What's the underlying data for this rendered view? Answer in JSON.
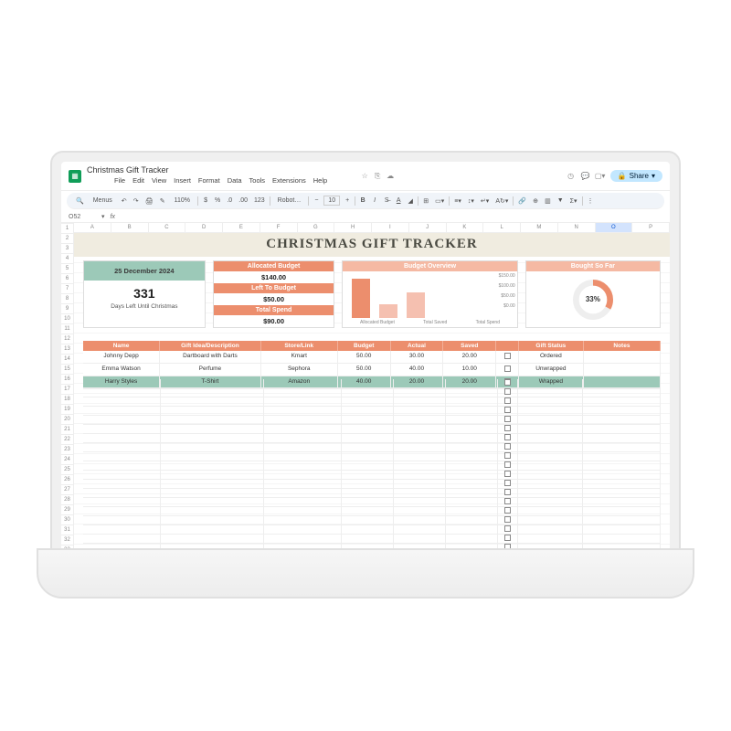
{
  "document": {
    "title": "Christmas Gift Tracker",
    "app_icon": "gsheets"
  },
  "menu": [
    "File",
    "Edit",
    "View",
    "Insert",
    "Format",
    "Data",
    "Tools",
    "Extensions",
    "Help"
  ],
  "toolbar": {
    "zoom": "110%",
    "font": "Robot…",
    "font_size": "10",
    "menus_label": "Menus"
  },
  "header_icons": {
    "history": "history",
    "comment": "comment",
    "meet": "meet",
    "share_label": "Share"
  },
  "cell_reference": "O52",
  "columns": [
    "A",
    "B",
    "C",
    "D",
    "E",
    "F",
    "G",
    "H",
    "I",
    "J",
    "K",
    "L",
    "M",
    "N",
    "O",
    "P"
  ],
  "selected_col_index": 14,
  "row_count": 36,
  "title": "CHRISTMAS GIFT TRACKER",
  "dates": {
    "target": "25 December 2024",
    "countdown_number": "331",
    "countdown_label": "Days Left Until Christmas"
  },
  "budget_boxes": [
    {
      "label": "Allocated Budget",
      "value": "$140.00"
    },
    {
      "label": "Left To Budget",
      "value": "$50.00"
    },
    {
      "label": "Total Spend",
      "value": "$90.00"
    }
  ],
  "budget_chart_title": "Budget Overview",
  "donut_title": "Bought So Far",
  "donut_percent": "33%",
  "table_headers": [
    "Name",
    "Gift Idea/Description",
    "Store/Link",
    "Budget",
    "Actual",
    "Saved",
    "",
    "Gift Status",
    "Notes"
  ],
  "table_rows": [
    {
      "name": "Johnny Depp",
      "gift": "Dartboard with Darts",
      "store": "Kmart",
      "budget": "50.00",
      "actual": "30.00",
      "saved": "20.00",
      "checked": false,
      "status": "Ordered",
      "notes": "",
      "hl": false
    },
    {
      "name": "Emma Watson",
      "gift": "Perfume",
      "store": "Sephora",
      "budget": "50.00",
      "actual": "40.00",
      "saved": "10.00",
      "checked": false,
      "status": "Unwrapped",
      "notes": "",
      "hl": false
    },
    {
      "name": "Harry Styles",
      "gift": "T-Shirt",
      "store": "Amazon",
      "budget": "40.00",
      "actual": "20.00",
      "saved": "20.00",
      "checked": true,
      "status": "Wrapped",
      "notes": "",
      "hl": true
    }
  ],
  "chart_data": {
    "type": "bar",
    "title": "Budget Overview",
    "categories": [
      "Allocated Budget",
      "Total Saved",
      "Total Spend"
    ],
    "values": [
      140,
      50,
      90
    ],
    "ylim": [
      0,
      150
    ],
    "yticks": [
      "$0.00",
      "$50.00",
      "$100.00",
      "$150.00"
    ]
  },
  "chart_data_donut": {
    "type": "pie",
    "title": "Bought So Far",
    "percent": 33
  }
}
